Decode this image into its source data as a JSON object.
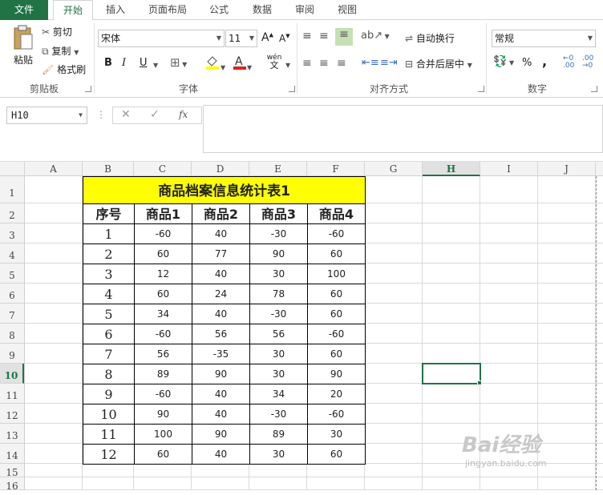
{
  "tabs": [
    "文件",
    "开始",
    "插入",
    "页面布局",
    "公式",
    "数据",
    "审阅",
    "视图"
  ],
  "ribbon": {
    "clipboard": {
      "paste": "粘贴",
      "cut": "剪切",
      "copy": "复制",
      "format_painter": "格式刷",
      "label": "剪贴板"
    },
    "font": {
      "name": "宋体",
      "size": "11",
      "bold": "B",
      "italic": "I",
      "underline": "U",
      "phonetic": "wén",
      "label": "字体",
      "grow": "A",
      "shrink": "A"
    },
    "alignment": {
      "wrap": "自动换行",
      "merge": "合并后居中",
      "label": "对齐方式"
    },
    "number": {
      "format": "常规",
      "percent": "%",
      "comma": ",",
      "label": "数字"
    }
  },
  "formula_bar": {
    "name_box": "H10",
    "fx": "fx",
    "value": ""
  },
  "columns": [
    "A",
    "B",
    "C",
    "D",
    "E",
    "F",
    "G",
    "H",
    "I",
    "J"
  ],
  "rows": [
    "1",
    "2",
    "3",
    "4",
    "5",
    "6",
    "7",
    "8",
    "9",
    "10",
    "11",
    "12",
    "13",
    "14",
    "15",
    "16"
  ],
  "selected": {
    "column": "H",
    "row": "10"
  },
  "sheet": {
    "title": "商品档案信息统计表1",
    "headers": [
      "序号",
      "商品1",
      "商品2",
      "商品3",
      "商品4"
    ],
    "data": [
      [
        "1",
        "-60",
        "40",
        "-30",
        "-60"
      ],
      [
        "2",
        "60",
        "77",
        "90",
        "60"
      ],
      [
        "3",
        "12",
        "40",
        "30",
        "100"
      ],
      [
        "4",
        "60",
        "24",
        "78",
        "60"
      ],
      [
        "5",
        "34",
        "40",
        "-30",
        "60"
      ],
      [
        "6",
        "-60",
        "56",
        "56",
        "-60"
      ],
      [
        "7",
        "56",
        "-35",
        "30",
        "60"
      ],
      [
        "8",
        "89",
        "90",
        "30",
        "90"
      ],
      [
        "9",
        "-60",
        "40",
        "34",
        "20"
      ],
      [
        "10",
        "90",
        "40",
        "-30",
        "-60"
      ],
      [
        "11",
        "100",
        "90",
        "89",
        "30"
      ],
      [
        "12",
        "60",
        "40",
        "30",
        "60"
      ]
    ]
  },
  "watermark": {
    "text": "Bai经验",
    "sub": "jingyan.baidu.com"
  },
  "colors": {
    "accent": "#217346",
    "title_fill": "#ffff00"
  }
}
